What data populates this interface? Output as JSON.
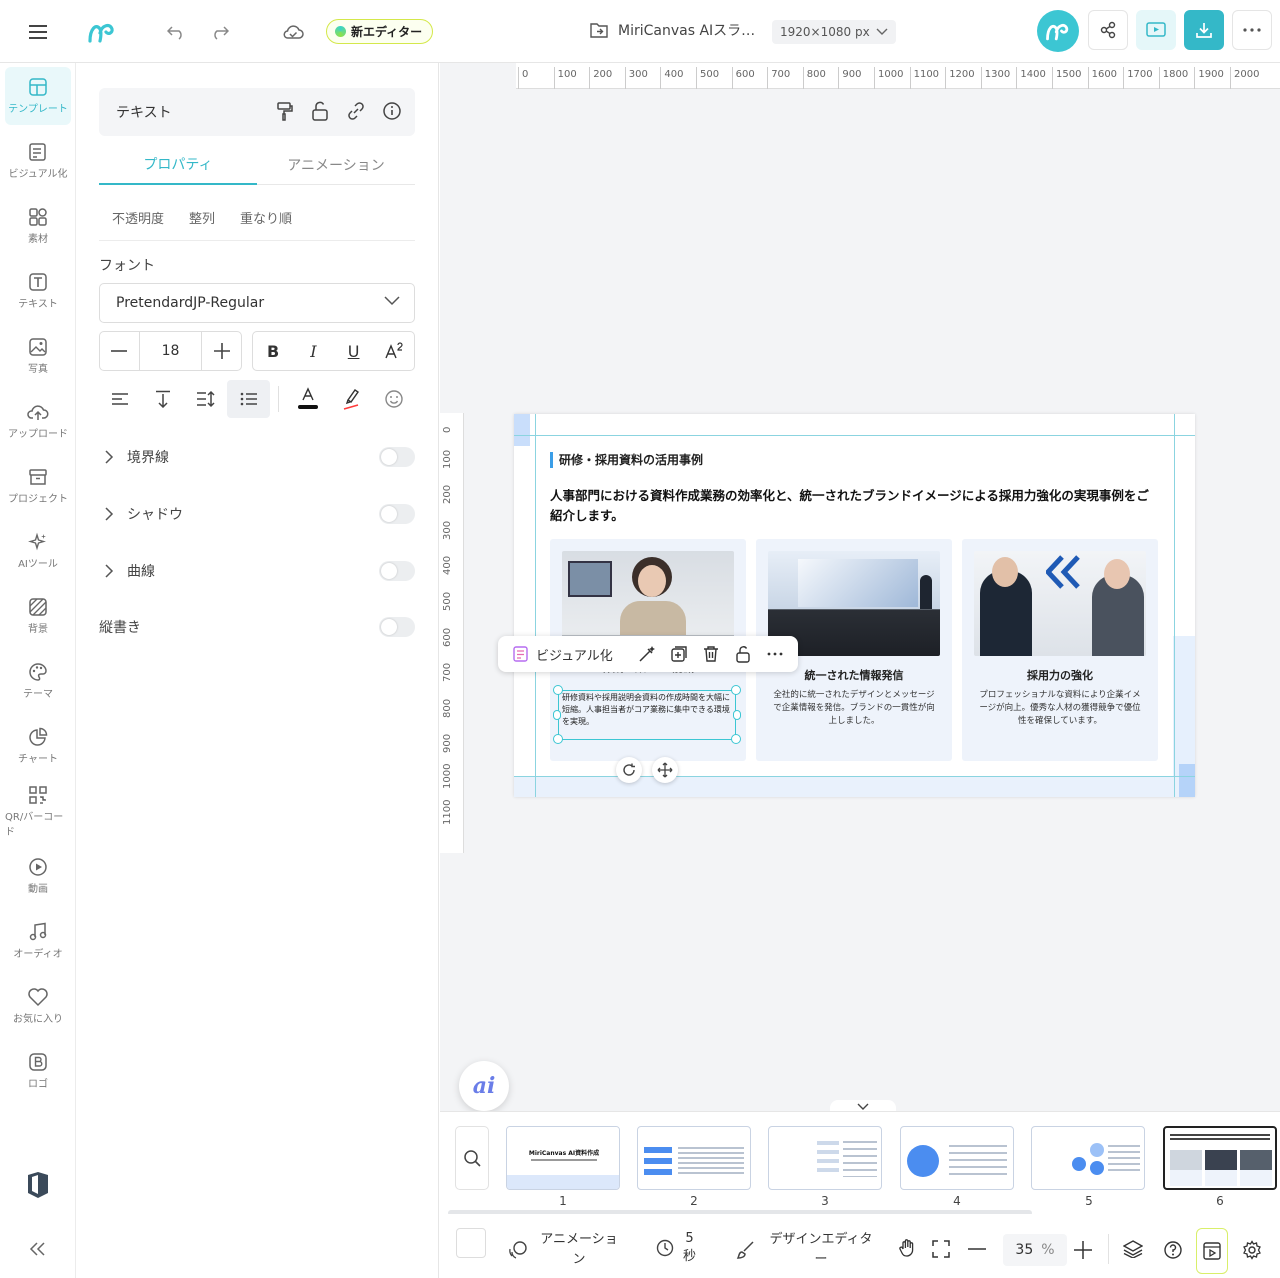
{
  "topbar": {
    "new_editor_label": "新エディター",
    "doc_title": "MiriCanvas AIスラ…",
    "canvas_size": "1920×1080 px"
  },
  "rail": {
    "items": [
      {
        "label": "テンプレート",
        "icon": "template-icon"
      },
      {
        "label": "ビジュアル化",
        "icon": "visualize-icon"
      },
      {
        "label": "素材",
        "icon": "elements-icon"
      },
      {
        "label": "テキスト",
        "icon": "text-icon"
      },
      {
        "label": "写真",
        "icon": "photo-icon"
      },
      {
        "label": "アップロード",
        "icon": "upload-icon"
      },
      {
        "label": "プロジェクト",
        "icon": "project-icon"
      },
      {
        "label": "AIツール",
        "icon": "ai-tools-icon"
      },
      {
        "label": "背景",
        "icon": "background-icon"
      },
      {
        "label": "テーマ",
        "icon": "theme-icon"
      },
      {
        "label": "チャート",
        "icon": "chart-icon"
      },
      {
        "label": "QR/バーコード",
        "icon": "qr-icon"
      },
      {
        "label": "動画",
        "icon": "video-icon"
      },
      {
        "label": "オーディオ",
        "icon": "audio-icon"
      },
      {
        "label": "お気に入り",
        "icon": "heart-icon"
      },
      {
        "label": "ロゴ",
        "icon": "logo-icon"
      }
    ]
  },
  "panel": {
    "selection_type": "テキスト",
    "tabs": [
      "プロパティ",
      "アニメーション"
    ],
    "subtabs": [
      "不透明度",
      "整列",
      "重なり順"
    ],
    "font_label": "フォント",
    "font_value": "PretendardJP-Regular",
    "font_size": "18",
    "style_b": "B",
    "style_i": "I",
    "style_u": "U",
    "border_label": "境界線",
    "shadow_label": "シャドウ",
    "curve_label": "曲線",
    "vertical_label": "縦書き",
    "text_color": "#111111",
    "highlight_color": "#ff3b3b",
    "accent": "#34b8c8"
  },
  "ruler": {
    "h": [
      "0",
      "100",
      "200",
      "300",
      "400",
      "500",
      "600",
      "700",
      "800",
      "900",
      "1000",
      "1100",
      "1200",
      "1300",
      "1400",
      "1500",
      "1600",
      "1700",
      "1800",
      "1900",
      "2000"
    ],
    "v": [
      "0",
      "100",
      "200",
      "300",
      "400",
      "500",
      "600",
      "700",
      "800",
      "900",
      "1000",
      "1100"
    ]
  },
  "slide": {
    "header": "研修・採用資料の活用事例",
    "description": "人事部門における資料作成業務の効率化と、統一されたブランドイメージによる採用力強化の実現事例をご紹介します。",
    "cards": [
      {
        "title": "作成工数70%削減",
        "body": "研修資料や採用説明会資料の作成時間を大幅に短縮。人事担当者がコア業務に集中できる環境を実現。"
      },
      {
        "title": "統一された情報発信",
        "body": "全社的に統一されたデザインとメッセージで企業情報を発信。ブランドの一貫性が向上しました。"
      },
      {
        "title": "採用力の強化",
        "body": "プロフェッショナルな資料により企業イメージが向上。優秀な人材の獲得競争で優位性を確保しています。"
      }
    ]
  },
  "ctxbar": {
    "label": "ビジュアル化"
  },
  "ai_label": "ai",
  "pages": {
    "numbers": [
      "1",
      "2",
      "3",
      "4",
      "5",
      "6"
    ],
    "thumb1_title": "MiriCanvas AI資料作成"
  },
  "bottombar": {
    "animation": "アニメーション",
    "duration_value": "5",
    "duration_unit": "秒",
    "design_editor": "デザインエディター",
    "zoom": "35",
    "zoom_unit": "%"
  }
}
